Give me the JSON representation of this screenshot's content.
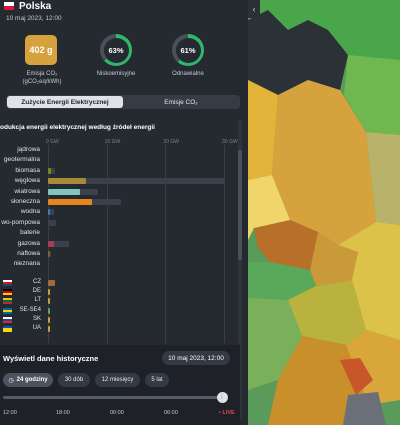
{
  "header": {
    "country": "Polska",
    "datetime": "10 maj 2023, 12:00"
  },
  "kpis": {
    "emission": {
      "value": "402 g",
      "label_line1": "Emisja CO₂",
      "label_line2": "(gCO₂eq/kWh)",
      "color": "#d6a23d"
    },
    "low_emission": {
      "value": "63%",
      "label": "Niskoemisyjne",
      "percent": 63,
      "color": "#2fb86b"
    },
    "renewable": {
      "value": "61%",
      "label": "Odnawialne",
      "percent": 61,
      "color": "#2fb86b"
    }
  },
  "tabs": [
    {
      "label": "Zużycie Energii Elektrycznej",
      "active": true
    },
    {
      "label": "Emisje CO₂",
      "active": false
    }
  ],
  "chart": {
    "title": "odukcja energii elektrycznej według źródeł energii",
    "ticks": [
      "0 GW",
      "10 GW",
      "20 GW",
      "30 GW"
    ]
  },
  "chart_data": {
    "type": "bar",
    "orientation": "horizontal",
    "unit": "GW",
    "xlim": [
      0,
      30
    ],
    "ticks": [
      0,
      10,
      20,
      30
    ],
    "sources": [
      {
        "label": "jądrowa",
        "value": 0,
        "capacity": 0,
        "color": "#8a6fc0"
      },
      {
        "label": "geotermalna",
        "value": 0,
        "capacity": 0,
        "color": "#d95f5f"
      },
      {
        "label": "biomasa",
        "value": 0.5,
        "capacity": 1.2,
        "color": "#6b8e23"
      },
      {
        "label": "węglowa",
        "value": 6.5,
        "capacity": 30,
        "color": "#a68a3c"
      },
      {
        "label": "wiatrowa",
        "value": 5.5,
        "capacity": 8.5,
        "color": "#7fc6bf"
      },
      {
        "label": "słoneczna",
        "value": 7.5,
        "capacity": 12.5,
        "color": "#e8841c"
      },
      {
        "label": "wodna",
        "value": 0.2,
        "capacity": 1,
        "color": "#3c78c8"
      },
      {
        "label": "wo-pompowa",
        "value": 0,
        "capacity": 1.4,
        "color": "#4a8fd8"
      },
      {
        "label": "baterie",
        "value": 0,
        "capacity": 0,
        "color": "#66bb66"
      },
      {
        "label": "gazowa",
        "value": 1,
        "capacity": 3.5,
        "color": "#a83a5a"
      },
      {
        "label": "naftowa",
        "value": 0.1,
        "capacity": 0.5,
        "color": "#8b5a2b"
      },
      {
        "label": "nieznana",
        "value": 0,
        "capacity": 0,
        "color": "#9aa0a6"
      }
    ],
    "exchanges": [
      {
        "label": "CZ",
        "value": 1.2,
        "color": "#a06a3a"
      },
      {
        "label": "DE",
        "value": 0.4,
        "color": "#c9a03a"
      },
      {
        "label": "LT",
        "value": 0.4,
        "color": "#c9a03a"
      },
      {
        "label": "SE-SE4",
        "value": 0.2,
        "color": "#5aa85a"
      },
      {
        "label": "SK",
        "value": 0.4,
        "color": "#c9a03a"
      },
      {
        "label": "UA",
        "value": 0.3,
        "color": "#c9a03a"
      }
    ]
  },
  "history": {
    "title": "Wyświetl dane historyczne",
    "date_button": "10 maj 2023, 12:00",
    "ranges": [
      "24 godziny",
      "30 dób",
      "12 miesięcy",
      "5 lat"
    ],
    "active_range": "24 godziny",
    "slider_ticks": [
      "12:00",
      "18:00",
      "00:00",
      "06:00"
    ],
    "live_label": "• LIVE",
    "slider_position": 1.0
  },
  "map": {
    "collapse_label": "‹"
  }
}
